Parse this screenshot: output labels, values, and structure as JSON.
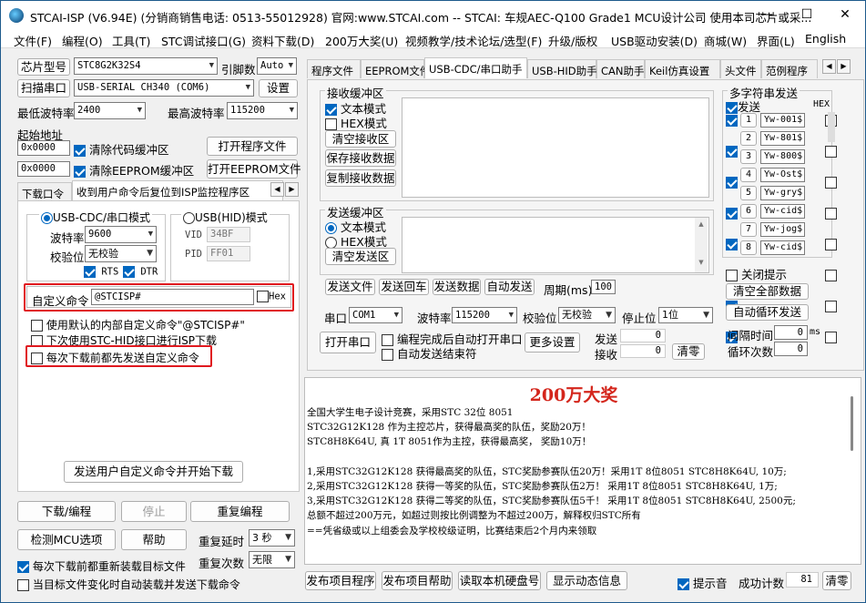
{
  "window": {
    "title": "STCAI-ISP (V6.94E) (分销商销售电话: 0513-55012928) 官网:www.STCAI.com  -- STCAI: 车规AEC-Q100 Grade1 MCU设计公司 使用本司芯片或采..."
  },
  "menu": [
    "文件(F)",
    "编程(O)",
    "工具(T)",
    "STC调试接口(G)",
    "资料下载(D)",
    "200万大奖(U)",
    "视频教学/技术论坛/选型(F)",
    "升级/版权",
    "USB驱动安装(D)",
    "商城(W)",
    "界面(L)",
    "English"
  ],
  "left": {
    "chip_label": "芯片型号",
    "chip_value": "STC8G2K32S4",
    "pins_label": "引脚数",
    "pins_value": "Auto",
    "scan_button": "扫描串口",
    "port_value": "USB-SERIAL CH340 (COM6)",
    "settings_button": "设置",
    "min_baud_label": "最低波特率",
    "min_baud_value": "2400",
    "max_baud_label": "最高波特率",
    "max_baud_value": "115200",
    "start_addr_label": "起始地址",
    "addr1": "0x0000",
    "clear_code": "清除代码缓冲区",
    "open_prog": "打开程序文件",
    "addr2": "0x0000",
    "clear_eeprom": "清除EEPROM缓冲区",
    "open_eeprom": "打开EEPROM文件",
    "tabs": [
      "下载口令",
      "收到用户命令后复位到ISP监控程序区"
    ],
    "usbcdc_mode": "USB-CDC/串口模式",
    "usbhid_mode": "USB(HID)模式",
    "baud_label": "波特率",
    "baud_value": "9600",
    "vid_label": "VID",
    "vid_value": "34BF",
    "parity_label": "校验位",
    "parity_value": "无校验",
    "pid_label": "PID",
    "pid_value": "FF01",
    "rts": "RTS",
    "dtr": "DTR",
    "custom_cmd_label": "自定义命令",
    "custom_cmd_value": "@STCISP#",
    "hex_label": "Hex",
    "use_default_cmd": "使用默认的内部自定义命令\"@STCISP#\"",
    "next_hid": "下次使用STC-HID接口进行ISP下载",
    "send_before": "每次下载前都先发送自定义命令",
    "send_start_button": "发送用户自定义命令并开始下载",
    "download_button": "下载/编程",
    "stop_button": "停止",
    "repeat_button": "重复编程",
    "detect_button": "检测MCU选项",
    "help_button": "帮助",
    "repeat_delay_label": "重复延时",
    "repeat_delay_value": "3 秒",
    "reload_label": "每次下载前都重新装载目标文件",
    "repeat_count_label": "重复次数",
    "repeat_count_value": "无限",
    "auto_load_label": "当目标文件变化时自动装载并发送下载命令"
  },
  "right": {
    "tabs": [
      "程序文件",
      "EEPROM文件",
      "USB-CDC/串口助手",
      "USB-HID助手",
      "CAN助手",
      "Keil仿真设置",
      "头文件",
      "范例程序"
    ],
    "recv_title": "接收缓冲区",
    "text_mode": "文本模式",
    "hex_mode": "HEX模式",
    "clear_recv": "清空接收区",
    "save_recv": "保存接收数据",
    "copy_recv": "复制接收数据",
    "send_title": "发送缓冲区",
    "clear_send": "清空发送区",
    "send_file": "发送文件",
    "send_return": "发送回车",
    "send_data": "发送数据",
    "auto_send": "自动发送",
    "period_label": "周期(ms)",
    "period_value": "100",
    "multi_title": "多字符串发送",
    "send_col": "发送",
    "hex_col": "HEX",
    "multi": [
      {
        "n": "1",
        "v": "Yw-001$"
      },
      {
        "n": "2",
        "v": "Yw-801$"
      },
      {
        "n": "3",
        "v": "Yw-800$"
      },
      {
        "n": "4",
        "v": "Yw-Ost$"
      },
      {
        "n": "5",
        "v": "Yw-gry$"
      },
      {
        "n": "6",
        "v": "Yw-cid$"
      },
      {
        "n": "7",
        "v": "Yw-jog$"
      },
      {
        "n": "8",
        "v": "Yw-cid$"
      }
    ],
    "close_hint": "关闭提示",
    "clear_all": "清空全部数据",
    "auto_loop": "自动循环发送",
    "interval_label": "间隔时间",
    "interval_value": "0",
    "interval_unit": "ms",
    "loop_count_label": "循环次数",
    "loop_count_value": "0",
    "port_label": "串口",
    "port_value": "COM1",
    "baud_label": "波特率",
    "baud_value": "115200",
    "parity_label": "校验位",
    "parity_value": "无校验",
    "stop_label": "停止位",
    "stop_value": "1位",
    "open_port": "打开串口",
    "auto_open": "编程完成后自动打开串口",
    "auto_end": "自动发送结束符",
    "more_settings": "更多设置",
    "send_count_label": "发送",
    "send_count": "0",
    "recv_count_label": "接收",
    "recv_count": "0",
    "clear_count": "清零"
  },
  "info": {
    "title": "200万大奖",
    "lines": [
      "全国大学生电子设计竞赛，采用STC 32位 8051",
      "STC32G12K128 作为主控芯片，获得最高奖的队伍，奖励20万！",
      "STC8H8K64U, 真 1T 8051作为主控，获得最高奖， 奖励10万！",
      "",
      "1,采用STC32G12K128 获得最高奖的队伍，STC奖励参赛队伍20万！采用1T 8位8051 STC8H8K64U, 10万;",
      "2,采用STC32G12K128 获得一等奖的队伍，STC奖励参赛队伍2万！ 采用1T 8位8051 STC8H8K64U, 1万;",
      "3,采用STC32G12K128 获得二等奖的队伍，STC奖励参赛队伍5千！ 采用1T 8位8051 STC8H8K64U, 2500元;",
      "总额不超过200万元，如超过则按比例调整为不超过200万，解释权归STC所有",
      "==凭省级或以上组委会及学校校级证明，比赛结束后2个月内来领取"
    ]
  },
  "bottom": {
    "publish_prog": "发布项目程序",
    "publish_help": "发布项目帮助",
    "read_disk": "读取本机硬盘号",
    "show_anim": "显示动态信息",
    "beep_label": "提示音",
    "success_label": "成功计数",
    "success_value": "81",
    "clear_button": "清零"
  },
  "colors": {
    "accent": "#0067c0",
    "highlight": "#e0191f",
    "info_title": "#d4261c"
  }
}
